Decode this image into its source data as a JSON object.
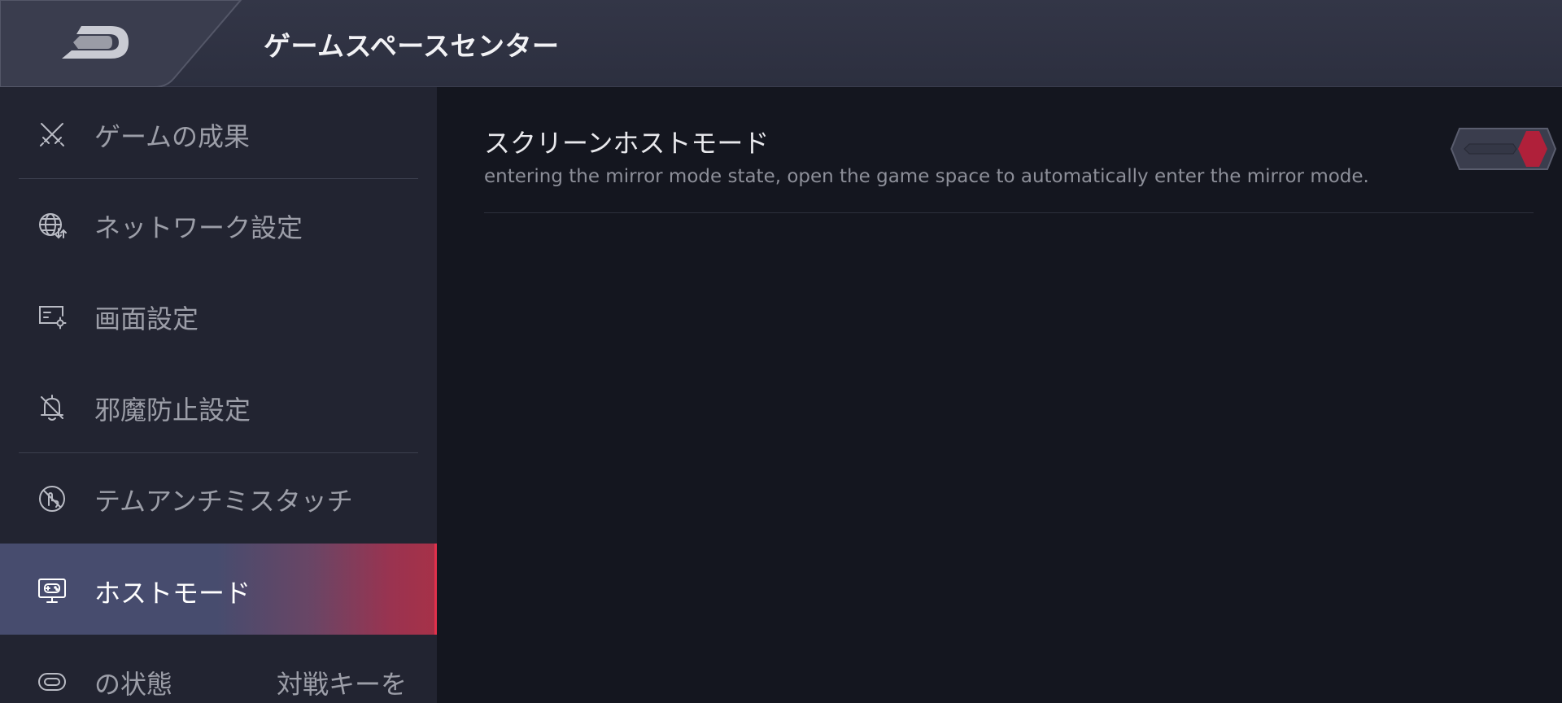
{
  "header": {
    "title": "ゲームスペースセンター",
    "back_icon": "back-logo-icon"
  },
  "sidebar": {
    "items": [
      {
        "label": "ゲームの成果",
        "icon": "crossed-swords-icon",
        "active": false
      },
      {
        "label": "ネットワーク設定",
        "icon": "globe-network-icon",
        "active": false
      },
      {
        "label": "画面設定",
        "icon": "display-settings-icon",
        "active": false
      },
      {
        "label": "邪魔防止設定",
        "icon": "bell-off-icon",
        "active": false
      },
      {
        "label": "テムアンチミスタッチ",
        "icon": "touch-block-icon",
        "active": false
      },
      {
        "label": "ホストモード",
        "icon": "monitor-gamepad-icon",
        "active": true
      },
      {
        "label": "の状態",
        "extra": "対戦キーを",
        "icon": "capsule-key-icon",
        "active": false
      }
    ]
  },
  "main": {
    "setting": {
      "title": "スクリーンホストモード",
      "description": "entering the mirror mode state, open the game space to automatically enter the mirror mode.",
      "toggle_on": true
    }
  },
  "colors": {
    "accent": "#e0304b",
    "toggle_knob": "#b0203a",
    "active_item_bg": "#474c6e",
    "sidebar_bg": "#222431",
    "main_bg": "#14161f",
    "header_bg": "#2f3242"
  }
}
